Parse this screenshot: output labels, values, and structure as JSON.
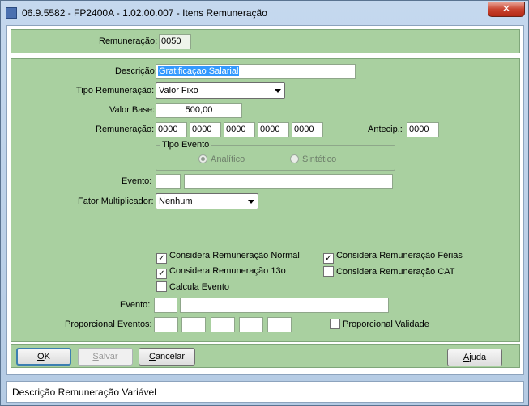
{
  "window": {
    "title": "06.9.5582 - FP2400A - 1.02.00.007 - Itens Remuneração",
    "close_glyph": "✕"
  },
  "top": {
    "remuneracao_label": "Remuneração:",
    "remuneracao_value": "0050"
  },
  "form": {
    "descricao_label": "Descrição:",
    "descricao_value": "Gratificaçao Salarial",
    "tipo_label": "Tipo Remuneração:",
    "tipo_value": "Valor Fixo",
    "valor_base_label": "Valor Base:",
    "valor_base_value": "500,00",
    "remun_label": "Remuneração:",
    "remun_values": [
      "0000",
      "0000",
      "0000",
      "0000",
      "0000"
    ],
    "antecip_label": "Antecip.:",
    "antecip_value": "0000",
    "tipo_evento_title": "Tipo Evento",
    "analitico_label": "Analítico",
    "sintetico_label": "Sintético",
    "evento_label": "Evento:",
    "evento_code": "",
    "evento_desc": "",
    "fator_label": "Fator Multiplicador:",
    "fator_value": "Nenhum",
    "checks": {
      "normal": "Considera Remuneração Normal",
      "ferias": "Considera Remuneração Férias",
      "decimo": "Considera Remuneração 13o",
      "cat": "Considera Remuneração CAT",
      "calcula": "Calcula Evento"
    },
    "checks_state": {
      "normal": true,
      "ferias": true,
      "decimo": true,
      "cat": false,
      "calcula": false
    },
    "evento2_label": "Evento:",
    "evento2_code": "",
    "evento2_desc": "",
    "proporcional_label": "Proporcional Eventos:",
    "proporcional_validade_label": "Proporcional Validade",
    "proporcional_validade_checked": false
  },
  "buttons": {
    "ok_u": "O",
    "ok_rest": "K",
    "salvar_u": "S",
    "salvar_rest": "alvar",
    "cancelar_u": "C",
    "cancelar_rest": "ancelar",
    "ajuda_u": "A",
    "ajuda_rest": "juda"
  },
  "status": {
    "text": "Descrição Remuneração Variável"
  },
  "colors": {
    "panel": "#a9d0a0",
    "selection": "#3399ff",
    "close": "#c8432f"
  }
}
